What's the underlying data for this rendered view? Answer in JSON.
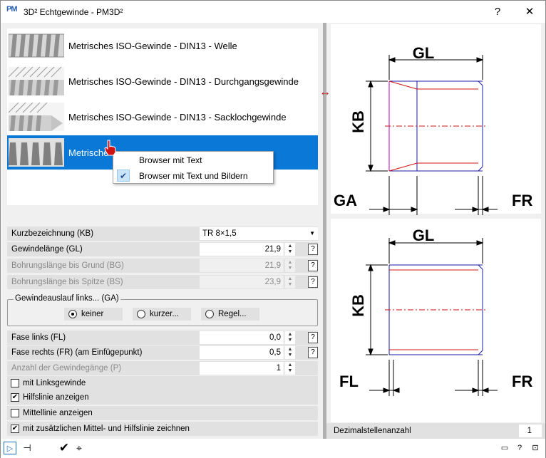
{
  "window": {
    "title": "3D² Echtgewinde  -  PM3D²",
    "logo": "PM",
    "help_glyph": "?",
    "close_glyph": "✕"
  },
  "thread_list": {
    "items": [
      {
        "label": "Metrisches ISO-Gewinde - DIN13 - Welle",
        "icon": "thread-shaft-thumbnail"
      },
      {
        "label": "Metrisches ISO-Gewinde - DIN13 - Durchgangsgewinde",
        "icon": "through-thread-thumbnail"
      },
      {
        "label": "Metrisches ISO-Gewinde - DIN13 - Sacklochgewinde",
        "icon": "blind-hole-thread-thumbnail"
      },
      {
        "label": "Metrische",
        "icon": "trapezoidal-thread-thumbnail",
        "selected": true
      }
    ]
  },
  "context_menu": {
    "items": [
      {
        "label": "Browser mit Text",
        "checked": false
      },
      {
        "label": "Browser mit Text und Bildern",
        "checked": true
      }
    ],
    "check_glyph": "✔"
  },
  "form": {
    "kurzbezeichnung": {
      "label": "Kurzbezeichnung  (KB)",
      "value": "TR 8×1,5"
    },
    "gewindelaenge": {
      "label": "Gewindelänge  (GL)",
      "value": "21,9"
    },
    "bohrungslaenge_grund": {
      "label": "Bohrungslänge bis Grund (BG)",
      "value": "21,9"
    },
    "bohrungslaenge_spitze": {
      "label": "Bohrungslänge bis Spitze  (BS)",
      "value": "23,9"
    },
    "gewindeauslauf": {
      "label": "Gewindeauslauf links...  (GA)",
      "options": [
        "keiner",
        "kurzer...",
        "Regel..."
      ],
      "selected": "keiner"
    },
    "fase_links": {
      "label": "Fase links  (FL)",
      "value": "0,0"
    },
    "fase_rechts": {
      "label": "Fase rechts  (FR) (am Einfügepunkt)",
      "value": "0,5"
    },
    "anzahl_gaenge": {
      "label": "Anzahl der Gewindegänge  (P)",
      "value": "1"
    },
    "mit_linksgewinde": {
      "label": "mit Linksgewinde",
      "checked": false
    },
    "hilfslinie": {
      "label": "Hilfslinie anzeigen",
      "checked": true
    },
    "mittellinie": {
      "label": "Mittellinie anzeigen",
      "checked": false
    },
    "zusaetzlich": {
      "label": "mit zusätzlichen Mittel- und Hilfslinie zeichnen",
      "checked": true
    },
    "help_glyph": "?",
    "spin_up": "▲",
    "spin_down": "▼",
    "dropdown_arrow": "▼",
    "check_glyph": "✔"
  },
  "diagram": {
    "top": {
      "gl": "GL",
      "kb": "KB",
      "ga": "GA",
      "fr": "FR"
    },
    "bottom": {
      "gl": "GL",
      "kb": "KB",
      "fl": "FL",
      "fr": "FR"
    }
  },
  "dezimal": {
    "label": "Dezimalstellenanzahl",
    "value": "1"
  },
  "statusbar": {
    "left_icons": [
      "dock-icon",
      "pin-icon",
      "ok-check-icon",
      "insert-icon"
    ],
    "ok_glyph": "✔",
    "right_icons": [
      "minimize-icon",
      "help-icon",
      "settings-icon"
    ],
    "help_glyph": "?"
  },
  "colors": {
    "selection": "#0a78d7",
    "dim_line_blue": "#1a1aa0",
    "chamfer_red": "#d01414",
    "magenta": "#c000c0"
  }
}
